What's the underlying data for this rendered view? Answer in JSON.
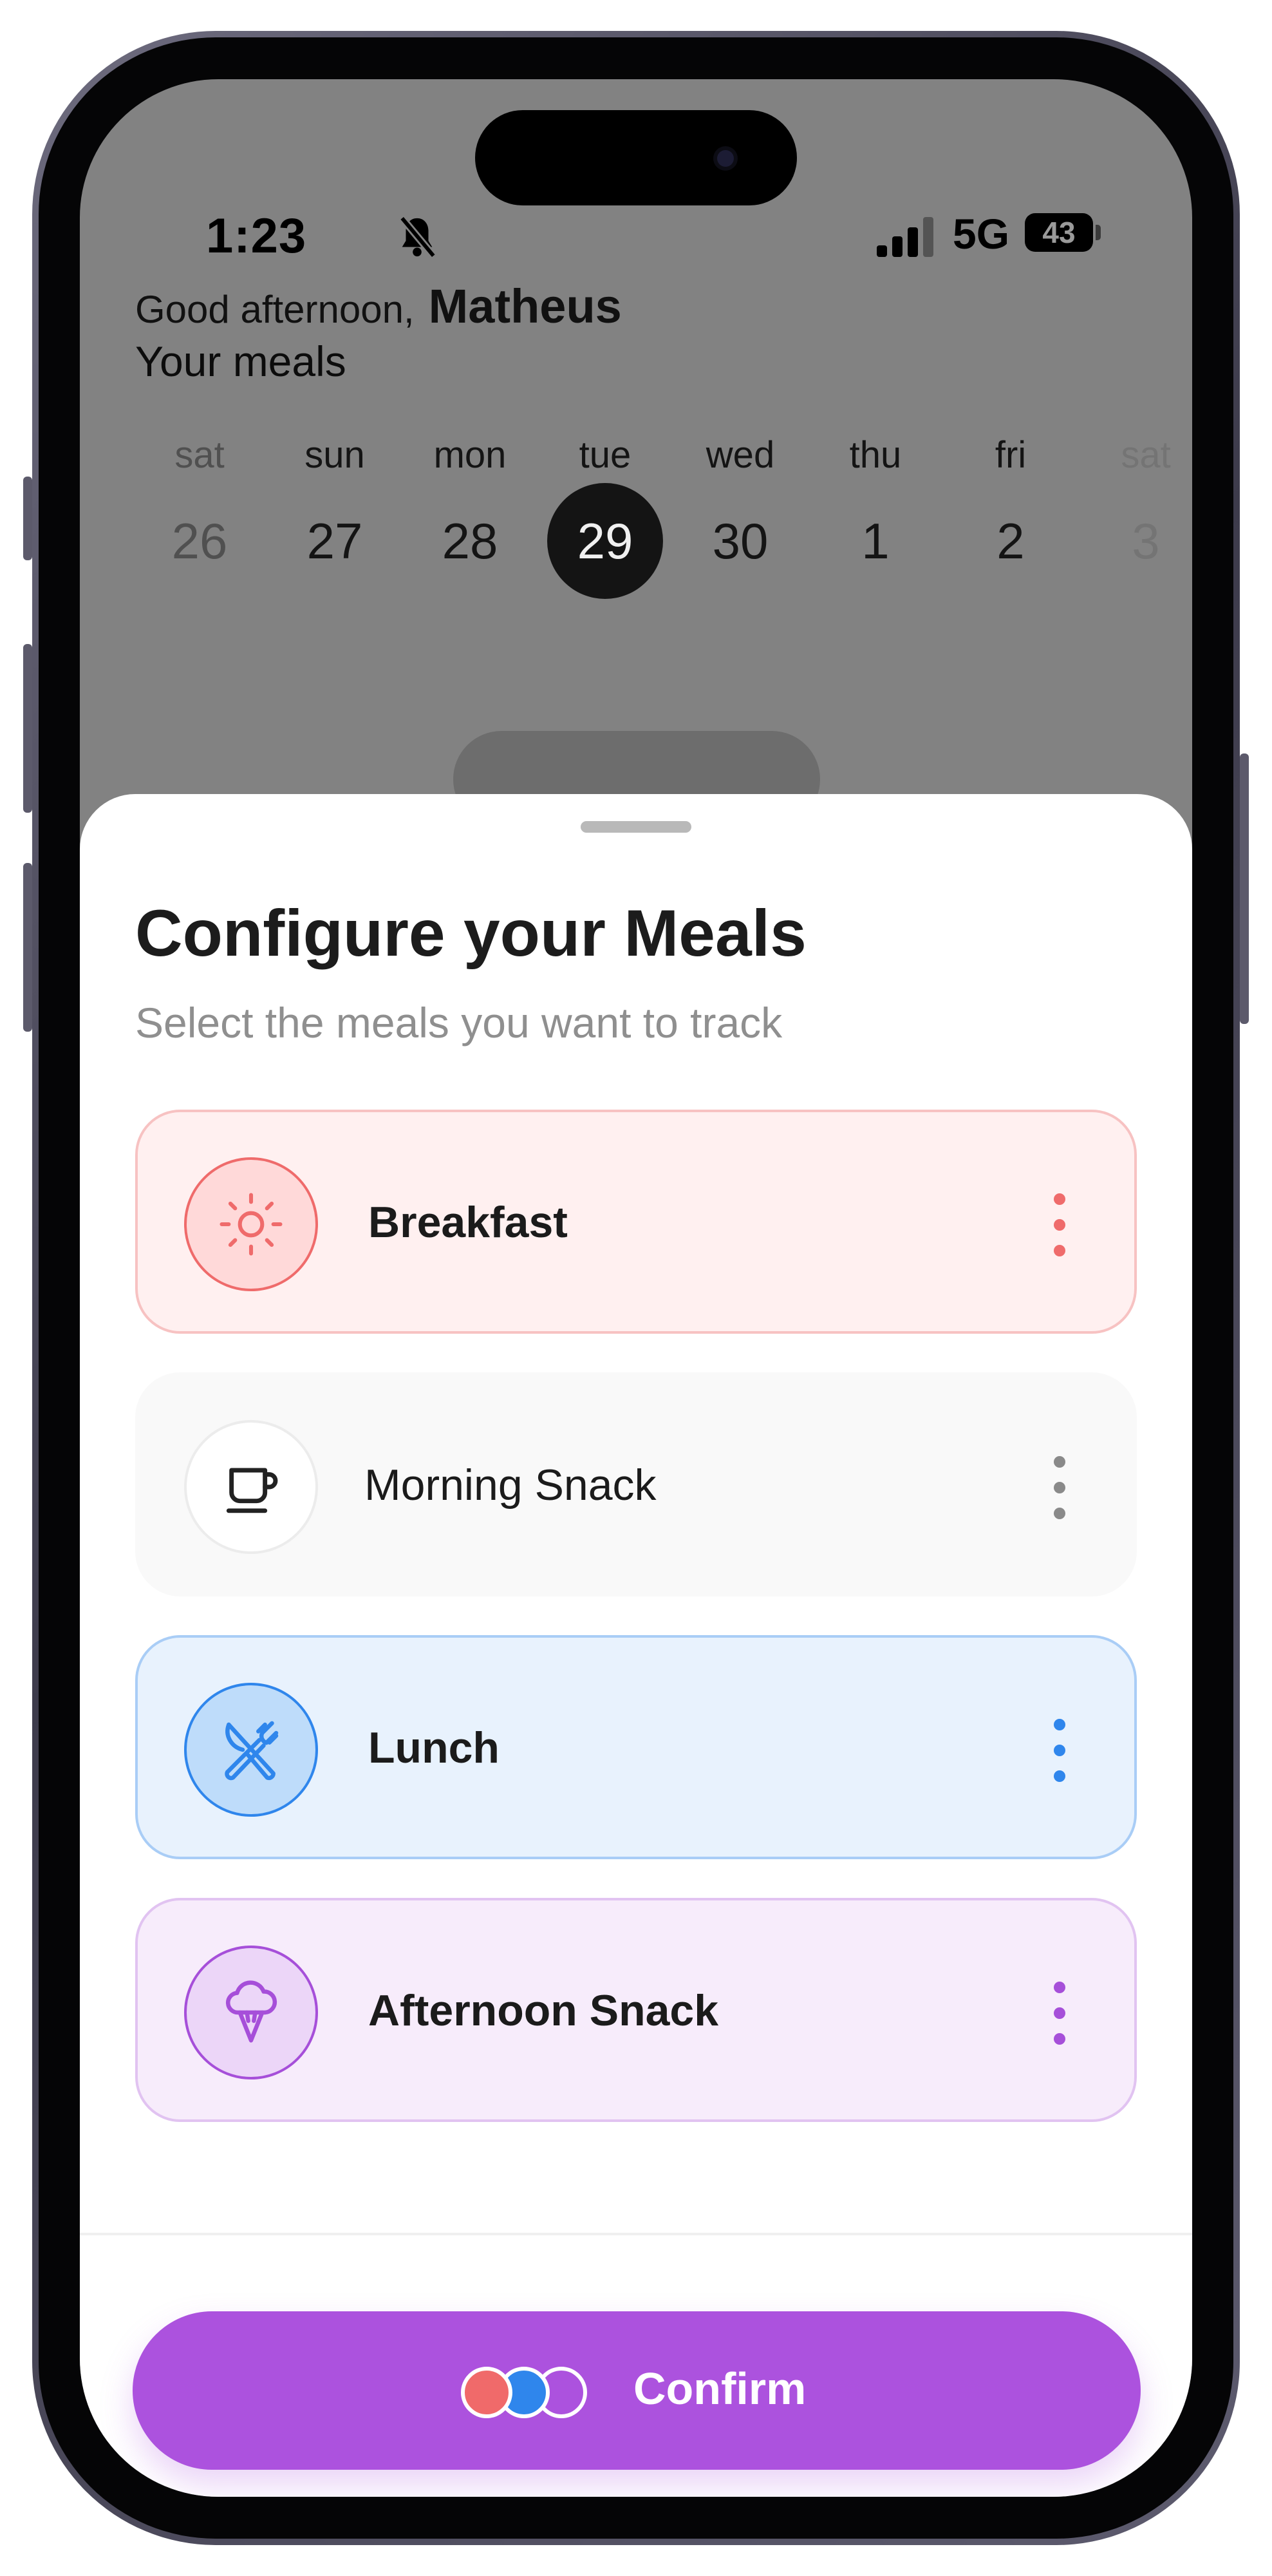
{
  "status_bar": {
    "time": "1:23",
    "network": "5G",
    "battery": "43"
  },
  "header": {
    "greeting": "Good afternoon,",
    "user_name": "Matheus",
    "section_title": "Your meals"
  },
  "calendar": {
    "days": [
      {
        "name": "sat",
        "number": "26"
      },
      {
        "name": "sun",
        "number": "27"
      },
      {
        "name": "mon",
        "number": "28"
      },
      {
        "name": "tue",
        "number": "29",
        "selected": true
      },
      {
        "name": "wed",
        "number": "30"
      },
      {
        "name": "thu",
        "number": "1"
      },
      {
        "name": "fri",
        "number": "2"
      },
      {
        "name": "sat",
        "number": "3"
      }
    ]
  },
  "sheet": {
    "title": "Configure your Meals",
    "subtitle": "Select the meals you want to track",
    "meals": [
      {
        "label": "Breakfast",
        "icon": "sun-icon",
        "selected": true,
        "color": "#ef6b6b"
      },
      {
        "label": "Morning Snack",
        "icon": "coffee-cup-icon",
        "selected": false,
        "color": "#222222"
      },
      {
        "label": "Lunch",
        "icon": "fork-knife-icon",
        "selected": true,
        "color": "#2f86ec"
      },
      {
        "label": "Afternoon Snack",
        "icon": "ice-cream-icon",
        "selected": true,
        "color": "#a64fd9"
      }
    ],
    "confirm_label": "Confirm",
    "confirm_color": "#ac52de"
  }
}
